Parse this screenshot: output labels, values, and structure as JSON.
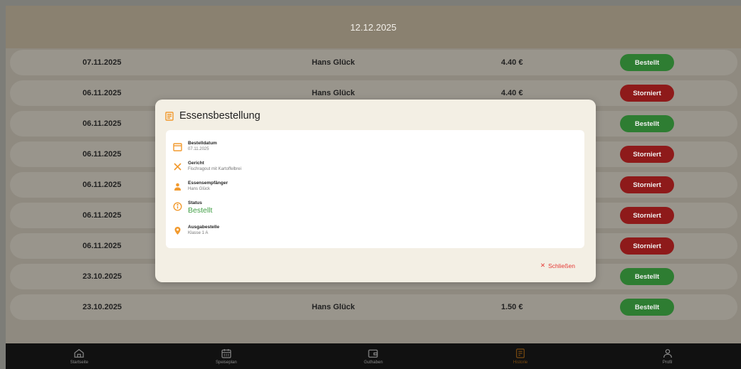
{
  "header": {
    "date": "12.12.2025"
  },
  "orders": [
    {
      "date": "07.11.2025",
      "name": "Hans Glück",
      "price": "4.40 €",
      "status": "Bestellt",
      "status_type": "ok"
    },
    {
      "date": "06.11.2025",
      "name": "Hans Glück",
      "price": "4.40 €",
      "status": "Storniert",
      "status_type": "cancel"
    },
    {
      "date": "06.11.2025",
      "name": "",
      "price": "",
      "status": "Bestellt",
      "status_type": "ok"
    },
    {
      "date": "06.11.2025",
      "name": "",
      "price": "",
      "status": "Storniert",
      "status_type": "cancel"
    },
    {
      "date": "06.11.2025",
      "name": "",
      "price": "",
      "status": "Storniert",
      "status_type": "cancel"
    },
    {
      "date": "06.11.2025",
      "name": "",
      "price": "",
      "status": "Storniert",
      "status_type": "cancel"
    },
    {
      "date": "06.11.2025",
      "name": "",
      "price": "",
      "status": "Storniert",
      "status_type": "cancel"
    },
    {
      "date": "23.10.2025",
      "name": "",
      "price": "",
      "status": "Bestellt",
      "status_type": "ok"
    },
    {
      "date": "23.10.2025",
      "name": "Hans Glück",
      "price": "1.50 €",
      "status": "Bestellt",
      "status_type": "ok"
    }
  ],
  "modal": {
    "title": "Essensbestellung",
    "fields": {
      "order_date": {
        "label": "Bestelldatum",
        "value": "07.11.2025"
      },
      "dish": {
        "label": "Gericht",
        "value": "Fischragout mit Kartoffelbrei"
      },
      "recipient": {
        "label": "Essensempfänger",
        "value": "Hans Glück"
      },
      "status": {
        "label": "Status",
        "value": "Bestellt"
      },
      "pickup": {
        "label": "Ausgabestelle",
        "value": "Klasse 1 A"
      }
    },
    "close_label": "Schließen"
  },
  "nav": {
    "items": [
      {
        "label": "Startseite",
        "icon": "home-icon"
      },
      {
        "label": "Speiseplan",
        "icon": "calendar-icon"
      },
      {
        "label": "Guthaben",
        "icon": "wallet-icon"
      },
      {
        "label": "Historie",
        "icon": "history-icon",
        "active": true
      },
      {
        "label": "Profil",
        "icon": "person-icon"
      }
    ]
  },
  "colors": {
    "accent": "#f29a2e",
    "status_ok": "#43a047",
    "status_cancel": "#c62828",
    "close": "#e53935"
  }
}
